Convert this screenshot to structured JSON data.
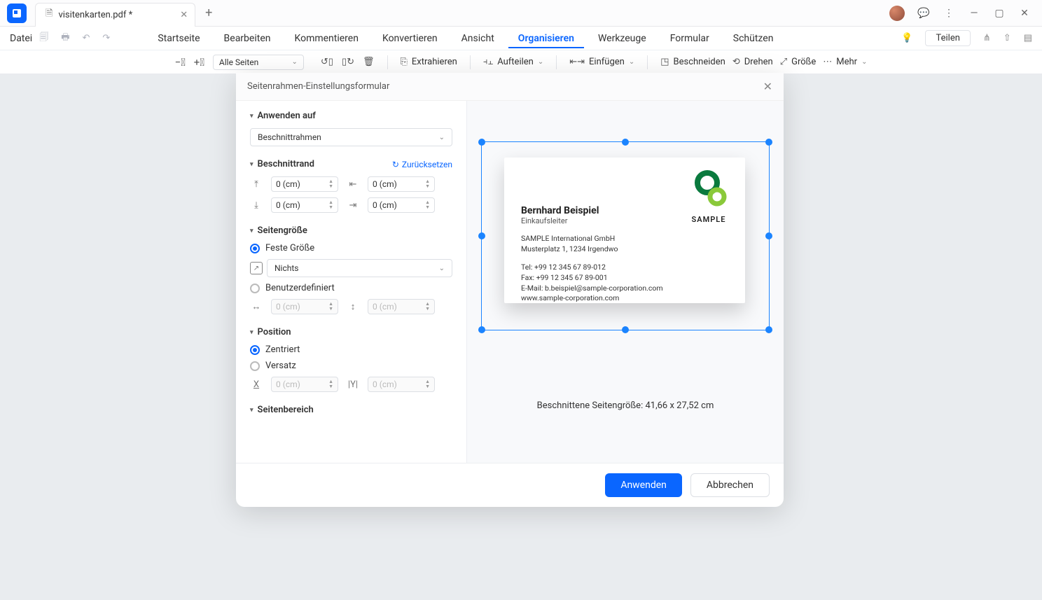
{
  "titlebar": {
    "tab_name": "visitenkarten.pdf *"
  },
  "menubar": {
    "file": "Datei",
    "tabs": [
      "Startseite",
      "Bearbeiten",
      "Kommentieren",
      "Konvertieren",
      "Ansicht",
      "Organisieren",
      "Werkzeuge",
      "Formular",
      "Schützen"
    ],
    "active_index": 5,
    "share": "Teilen"
  },
  "toolbar": {
    "page_selector": "Alle Seiten",
    "extract": "Extrahieren",
    "split": "Aufteilen",
    "insert": "Einfügen",
    "crop": "Beschneiden",
    "rotate": "Drehen",
    "size": "Größe",
    "more": "Mehr"
  },
  "dialog": {
    "title": "Seitenrahmen-Einstellungsformular",
    "apply_to_label": "Anwenden auf",
    "apply_to_value": "Beschnittrahmen",
    "margin_label": "Beschnittrand",
    "reset": "Zurücksetzen",
    "margin_top": "0 (cm)",
    "margin_bottom": "0 (cm)",
    "margin_left": "0 (cm)",
    "margin_right": "0 (cm)",
    "pagesize_label": "Seitengröße",
    "fixed_size": "Feste Größe",
    "fixed_value": "Nichts",
    "custom": "Benutzerdefiniert",
    "custom_w": "0 (cm)",
    "custom_h": "0 (cm)",
    "position_label": "Position",
    "centered": "Zentriert",
    "offset": "Versatz",
    "offset_x": "0 (cm)",
    "offset_y": "0 (cm)",
    "range_label": "Seitenbereich",
    "apply_btn": "Anwenden",
    "cancel_btn": "Abbrechen",
    "preview_info": "Beschnittene Seitengröße: 41,66 x 27,52 cm"
  },
  "card": {
    "name": "Bernhard Beispiel",
    "role": "Einkaufsleiter",
    "company": "SAMPLE International GmbH",
    "address": "Musterplatz 1, 1234 Irgendwo",
    "tel": "Tel: +99 12 345 67 89-012",
    "fax": "Fax:  +99 12 345 67 89-001",
    "email": "E-Mail: b.beispiel@sample-corporation.com",
    "web": "www.sample-corporation.com",
    "logo_text": "SAMPLE"
  }
}
